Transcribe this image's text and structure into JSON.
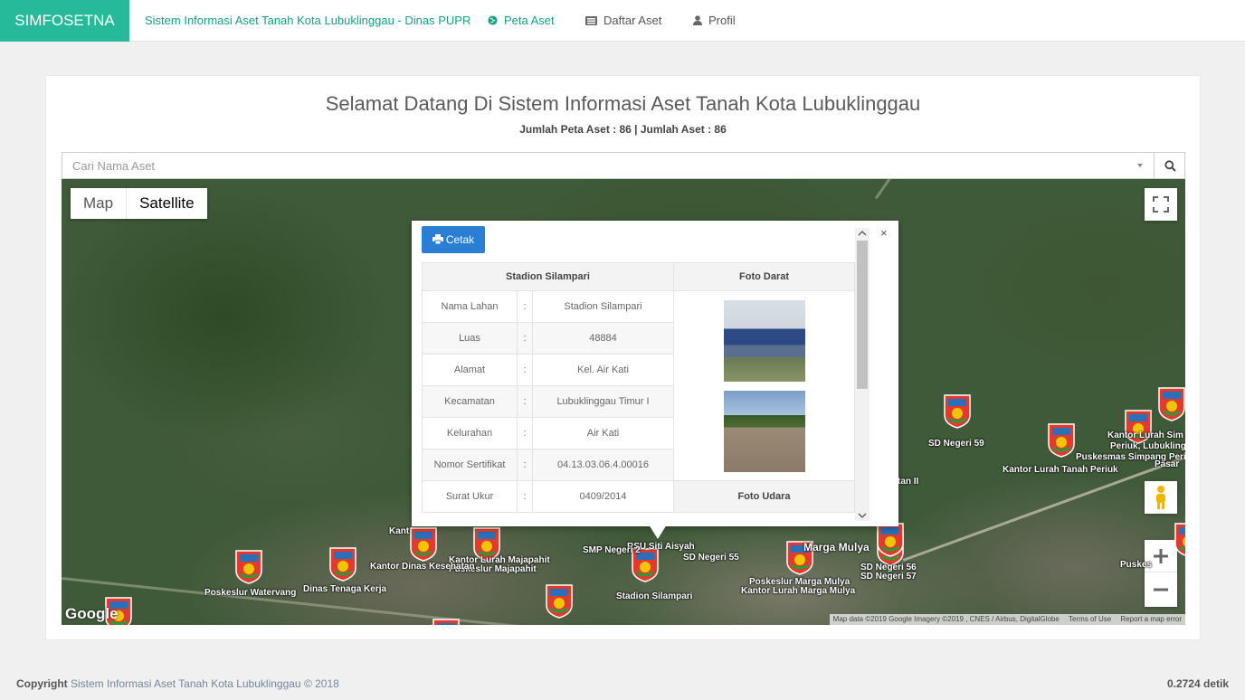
{
  "nav": {
    "brand": "SIMFOSETNA",
    "app_title": "Sistem Informasi Aset Tanah Kota Lubuklinggau - Dinas PUPR",
    "links": [
      {
        "label": "Peta Aset",
        "icon": "globe-icon"
      },
      {
        "label": "Daftar Aset",
        "icon": "list-icon"
      },
      {
        "label": "Profil",
        "icon": "user-icon"
      }
    ]
  },
  "main": {
    "title": "Selamat Datang Di Sistem Informasi Aset Tanah Kota Lubuklinggau",
    "summary": "Jumlah Peta Aset : 86 | Jumlah Aset : 86",
    "search_placeholder": "Cari Nama Aset"
  },
  "map": {
    "type_options": [
      "Map",
      "Satellite"
    ],
    "selected_type": "Satellite",
    "google_logo": "Google",
    "attribution": "Map data ©2019 Google Imagery ©2019 , CNES / Airbus, DigitalGlobe",
    "terms": "Terms of Use",
    "report": "Report a map error",
    "labels": [
      "SD Negeri 59",
      "Kantor Lurah Tanah Periuk",
      "Puskesmas Simpang Perii",
      "Periuk, Lubuklinggau",
      "Kantor Lurah Sim",
      "Pasar",
      "tan II",
      "Stadion Silampari",
      "RSU Siti Aisyah",
      "SD Negeri 55",
      "SMP Negeri 2",
      "Kantor Lurah Majapahit",
      "Puskeslur Majapahit",
      "Kantor Dinas Kesehatan",
      "Dinas Tenaga Kerja",
      "Poskeslur Watervang",
      "Poskeslur Marga Mulya",
      "Kantor Lurah Marga Mulya",
      "SD Negeri 56",
      "SD Negeri 57",
      "Marga Mulya",
      "Puskes",
      "Kant"
    ]
  },
  "popup": {
    "print_label": "Cetak",
    "close": "×",
    "header_name": "Stadion Silampari",
    "header_photo": "Foto Darat",
    "photo_udara": "Foto Udara",
    "rows": [
      {
        "label": "Nama Lahan",
        "value": "Stadion Silampari"
      },
      {
        "label": "Luas",
        "value": "48884"
      },
      {
        "label": "Alamat",
        "value": "Kel. Air Kati"
      },
      {
        "label": "Kecamatan",
        "value": "Lubuklinggau Timur I"
      },
      {
        "label": "Kelurahan",
        "value": "Air Kati"
      },
      {
        "label": "Nomor Sertifikat",
        "value": "04.13.03.06.4.00016"
      },
      {
        "label": "Surat Ukur",
        "value": "0409/2014"
      }
    ],
    "sep": ":"
  },
  "footer": {
    "copyright_bold": "Copyright",
    "copyright_text": " Sistem Informasi Aset Tanah Kota Lubuklinggau © 2018",
    "timing": "0.2724 detik"
  },
  "colors": {
    "brand": "#26b99a",
    "print_button": "#2a7fd4"
  }
}
